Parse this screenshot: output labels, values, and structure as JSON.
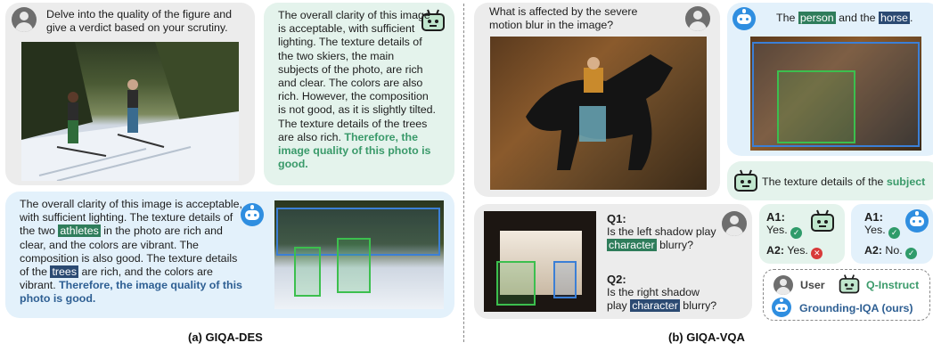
{
  "giqa_des": {
    "user_prompt": "Delve into the quality of the figure and give a verdict based on your scrutiny.",
    "qinstruct_answer": {
      "text": "The overall clarity of this image is acceptable, with sufficient lighting. The texture details of the two skiers, the main subjects of the photo, are rich and clear. The colors are also rich. However, the composition is not good, as it is slightly tilted. The texture details of the trees are also rich.",
      "verdict": "Therefore, the image quality of this photo is good."
    },
    "grounding_answer": {
      "part1": "The overall clarity of this image is acceptable, with sufficient lighting. The texture details of the two",
      "tag1": "athletes",
      "part2": "in the photo are rich and clear, and the colors are vibrant. The composition is also good. The texture details of the",
      "tag2": "trees",
      "part3": "are rich, and the colors are vibrant.",
      "verdict": "Therefore, the image quality of this photo is good."
    },
    "caption": "(a) GIQA-DES"
  },
  "giqa_vqa": {
    "question": "What is affected by the severe motion blur in the image?",
    "grounding_answer": {
      "prefix": "The",
      "tag1": "person",
      "mid": "and the",
      "tag2": "horse",
      "suffix": "."
    },
    "qinstruct_answer": {
      "prefix": "The texture details of the",
      "subject": "subject"
    },
    "q1": {
      "label": "Q1:",
      "text_pre": "Is the left shadow play",
      "tag": "character",
      "text_post": "blurry?"
    },
    "q2": {
      "label": "Q2:",
      "text_pre": "Is the right shadow play",
      "tag": "character",
      "text_post": "blurry?"
    },
    "qinstruct_result": {
      "a1_label": "A1:",
      "a1_value": "Yes.",
      "a2_label": "A2:",
      "a2_value": "Yes."
    },
    "grounding_result": {
      "a1_label": "A1:",
      "a1_value": "Yes.",
      "a2_label": "A2:",
      "a2_value": "No."
    },
    "legend": {
      "user": "User",
      "qinstruct": "Q-Instruct",
      "grounding": "Grounding-IQA (ours)"
    },
    "caption": "(b) GIQA-VQA"
  },
  "colors": {
    "gray_bubble": "#ececec",
    "green_bubble": "#e4f3ec",
    "blue_bubble": "#e3f1fb",
    "green_accent": "#3a9a6a",
    "blue_accent": "#2e5f93",
    "bbox_green": "#3cbf4e",
    "bbox_blue": "#3b7fd6"
  }
}
